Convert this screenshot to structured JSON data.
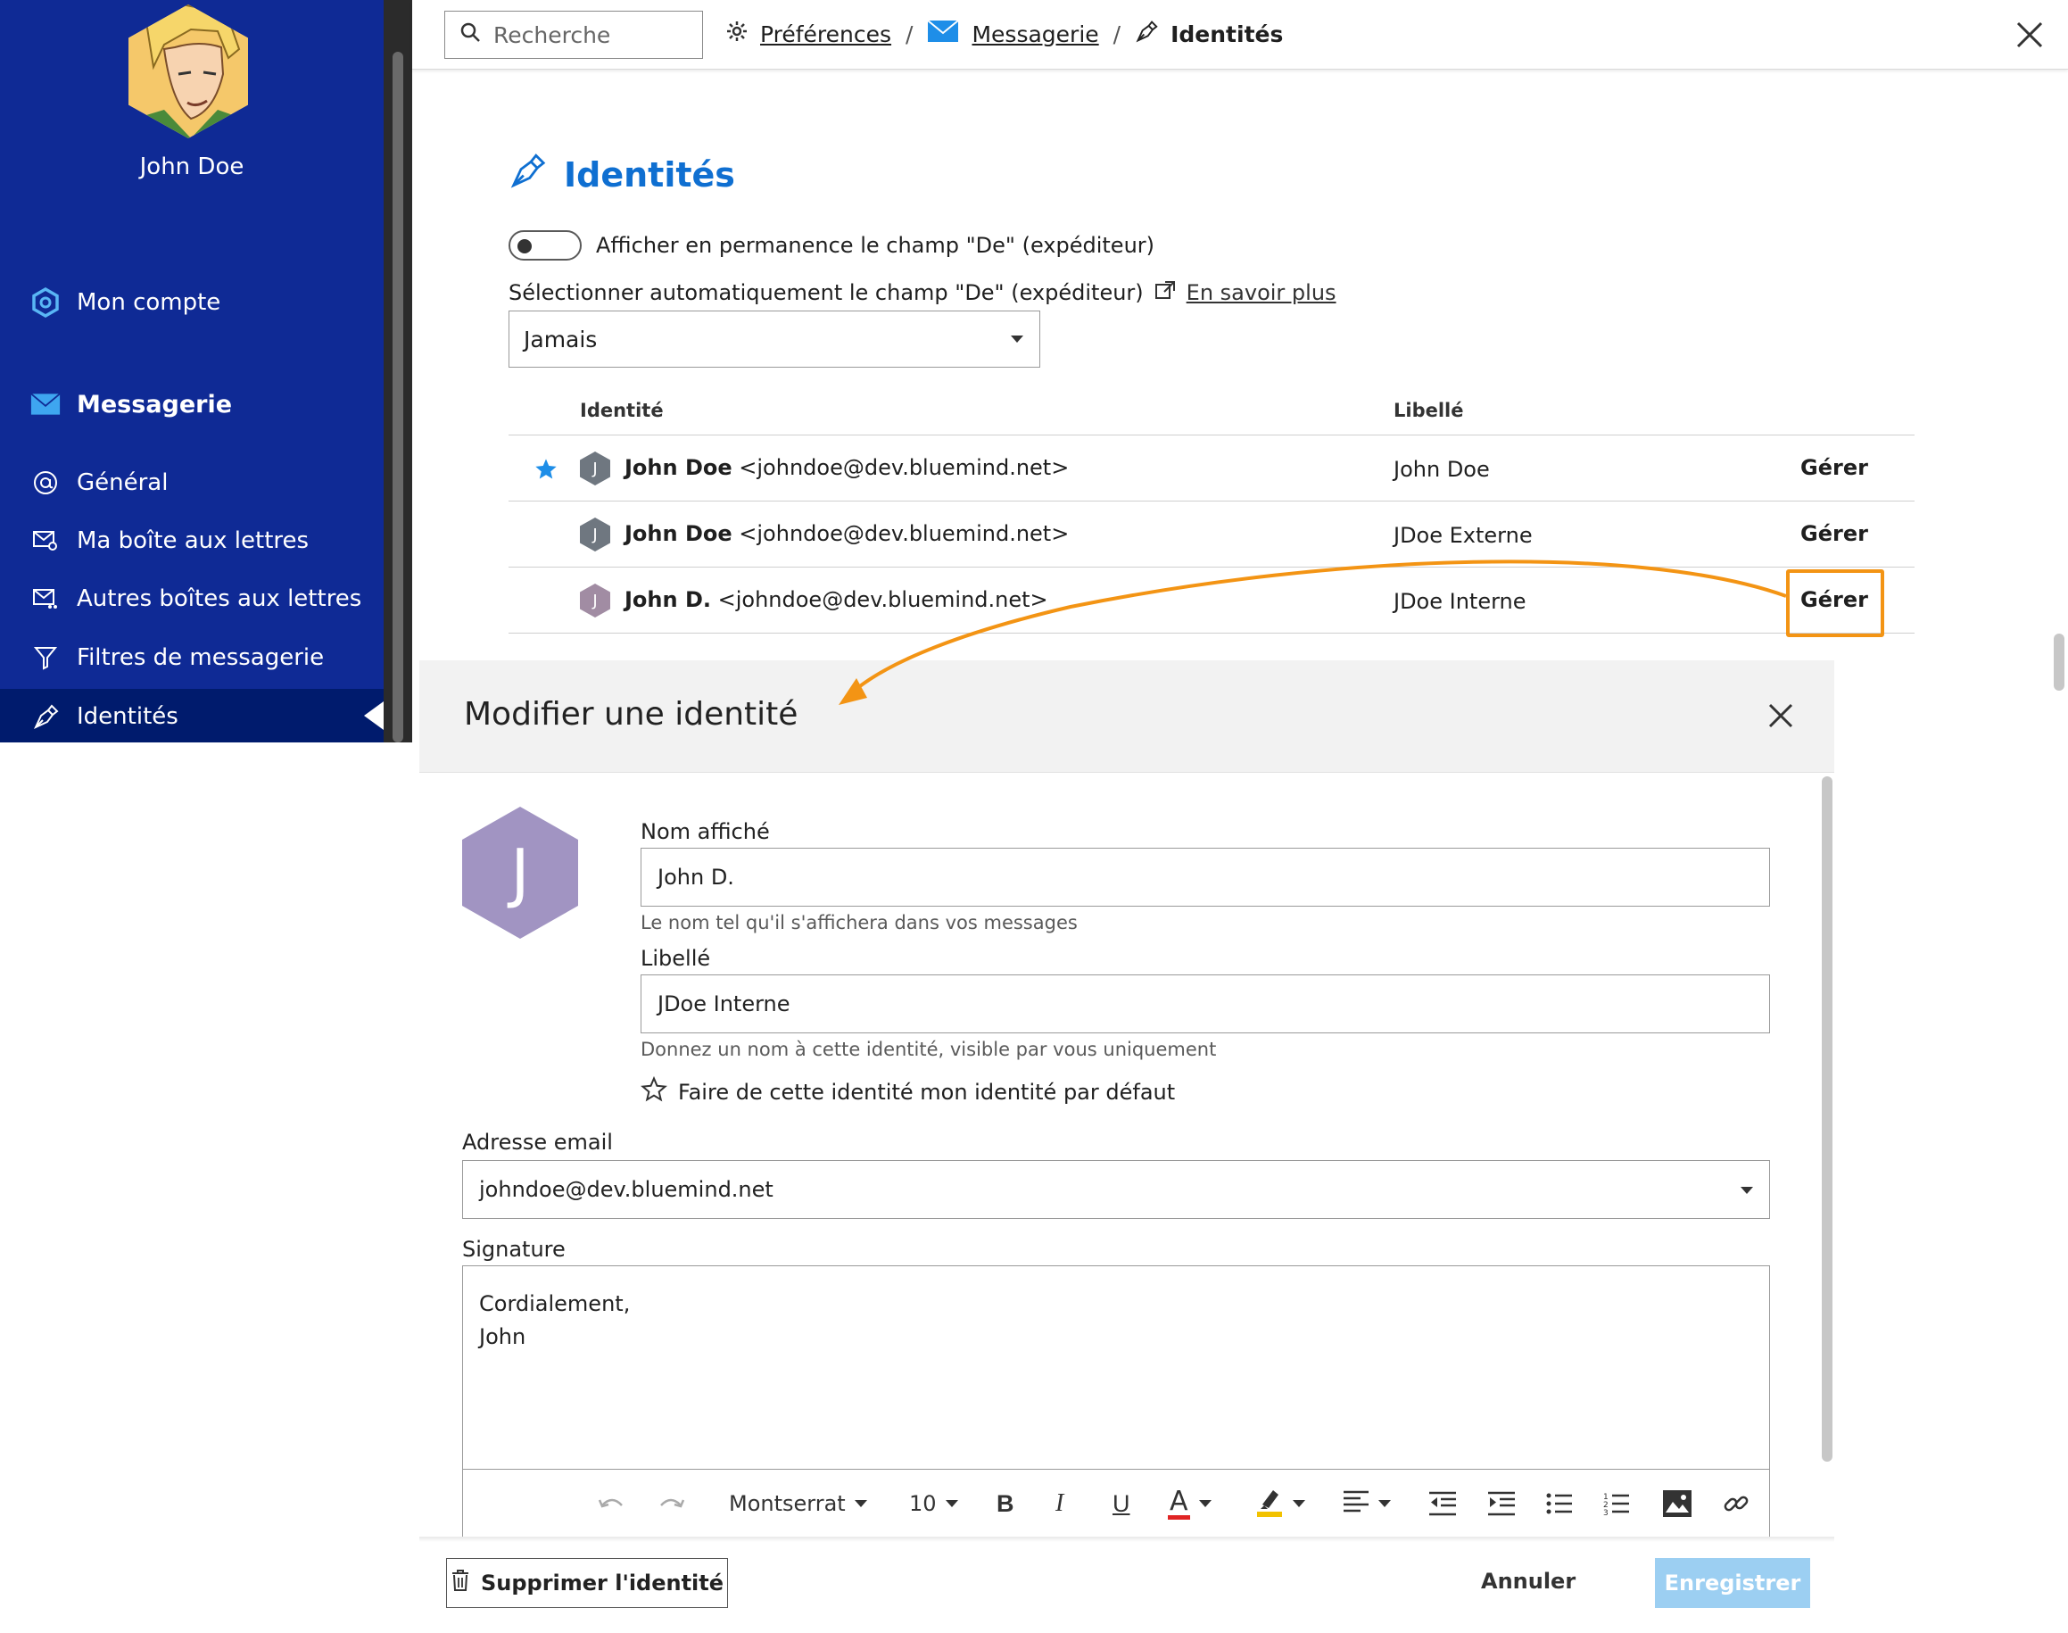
{
  "sidebar": {
    "user_name": "John Doe",
    "account_label": "Mon compte",
    "section_label": "Messagerie",
    "items": [
      {
        "label": "Général",
        "icon": "at-sign-icon"
      },
      {
        "label": "Ma boîte aux lettres",
        "icon": "mailbox-user-icon"
      },
      {
        "label": "Autres boîtes aux lettres",
        "icon": "mailbox-shared-icon"
      },
      {
        "label": "Filtres de messagerie",
        "icon": "filter-icon"
      },
      {
        "label": "Identités",
        "icon": "pen-nib-icon",
        "active": true
      }
    ],
    "background": "#0f2a95",
    "active_background": "#001b6d"
  },
  "topbar": {
    "search_placeholder": "Recherche",
    "breadcrumb": {
      "preferences": "Préférences",
      "messaging": "Messagerie",
      "current": "Identités"
    }
  },
  "page": {
    "title": "Identités",
    "toggle_label": "Afficher en permanence le champ \"De\" (expéditeur)",
    "toggle_on": false,
    "auto_select_label": "Sélectionner automatiquement le champ \"De\" (expéditeur)",
    "learn_more": "En savoir plus",
    "auto_select_value": "Jamais",
    "accent_color": "#0f6fd1"
  },
  "table": {
    "columns": [
      "Identité",
      "Libellé"
    ],
    "rows": [
      {
        "name": "John Doe",
        "email": "<johndoe@dev.bluemind.net>",
        "label": "John Doe",
        "action": "Gérer",
        "initial": "J",
        "default": true,
        "avatar_color": "#6f7780"
      },
      {
        "name": "John Doe",
        "email": "<johndoe@dev.bluemind.net>",
        "label": "JDoe Externe",
        "action": "Gérer",
        "initial": "J",
        "default": false,
        "avatar_color": "#6f7780"
      },
      {
        "name": "John D.",
        "email": "<johndoe@dev.bluemind.net>",
        "label": "JDoe Interne",
        "action": "Gérer",
        "initial": "J",
        "default": false,
        "avatar_color": "#a18ca3"
      }
    ],
    "highlight_color": "#f39414"
  },
  "modal": {
    "title": "Modifier une identité",
    "avatar_initial": "J",
    "avatar_color": "#a194c2",
    "display_name_label": "Nom affiché",
    "display_name_value": "John D.",
    "display_name_help": "Le nom tel qu'il s'affichera dans vos messages",
    "label_label": "Libellé",
    "label_value": "JDoe Interne",
    "label_help": "Donnez un nom à cette identité, visible par vous uniquement",
    "default_toggle": "Faire de cette identité mon identité par défaut",
    "email_label": "Adresse email",
    "email_value": "johndoe@dev.bluemind.net",
    "signature_label": "Signature",
    "signature_lines": [
      "Cordialement,",
      "John"
    ],
    "toolbar": {
      "font": "Montserrat",
      "size": "10",
      "bold": "B",
      "italic": "I",
      "underline": "U",
      "text_color": "A"
    },
    "delete_button": "Supprimer l'identité",
    "cancel_button": "Annuler",
    "save_button": "Enregistrer",
    "save_color": "#9ccff2"
  }
}
